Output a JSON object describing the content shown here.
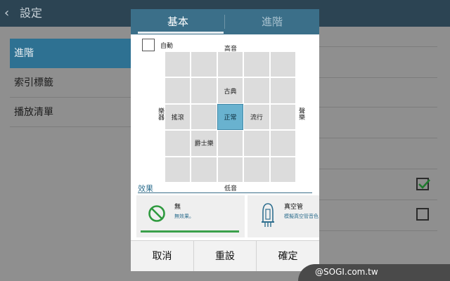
{
  "appbar": {
    "title": "設定"
  },
  "sidebar": {
    "items": [
      {
        "label": "進階"
      },
      {
        "label": "索引標籤"
      },
      {
        "label": "播放清單"
      }
    ]
  },
  "dialog": {
    "tabs": [
      {
        "label": "基本"
      },
      {
        "label": "進階"
      }
    ],
    "auto_label": "自動",
    "axis": {
      "high": "高音",
      "low": "低音",
      "left": "樂器",
      "right": "聲樂"
    },
    "grid_labels": {
      "classical": "古典",
      "rock": "搖滾",
      "normal": "正常",
      "pop": "流行",
      "jazz": "爵士樂"
    },
    "effects_title": "效果",
    "effects": [
      {
        "name": "無",
        "desc": "無效果。"
      },
      {
        "name": "真空管",
        "desc": "模擬真空管音色"
      }
    ],
    "buttons": {
      "cancel": "取消",
      "reset": "重設",
      "confirm": "確定"
    }
  },
  "watermark": "@SOGI.com.tw",
  "colors": {
    "accent": "#2e7192",
    "tab_bar": "#3b6f89",
    "selected_cell": "#69b2cf",
    "effect_bar": "#3aa04a"
  }
}
